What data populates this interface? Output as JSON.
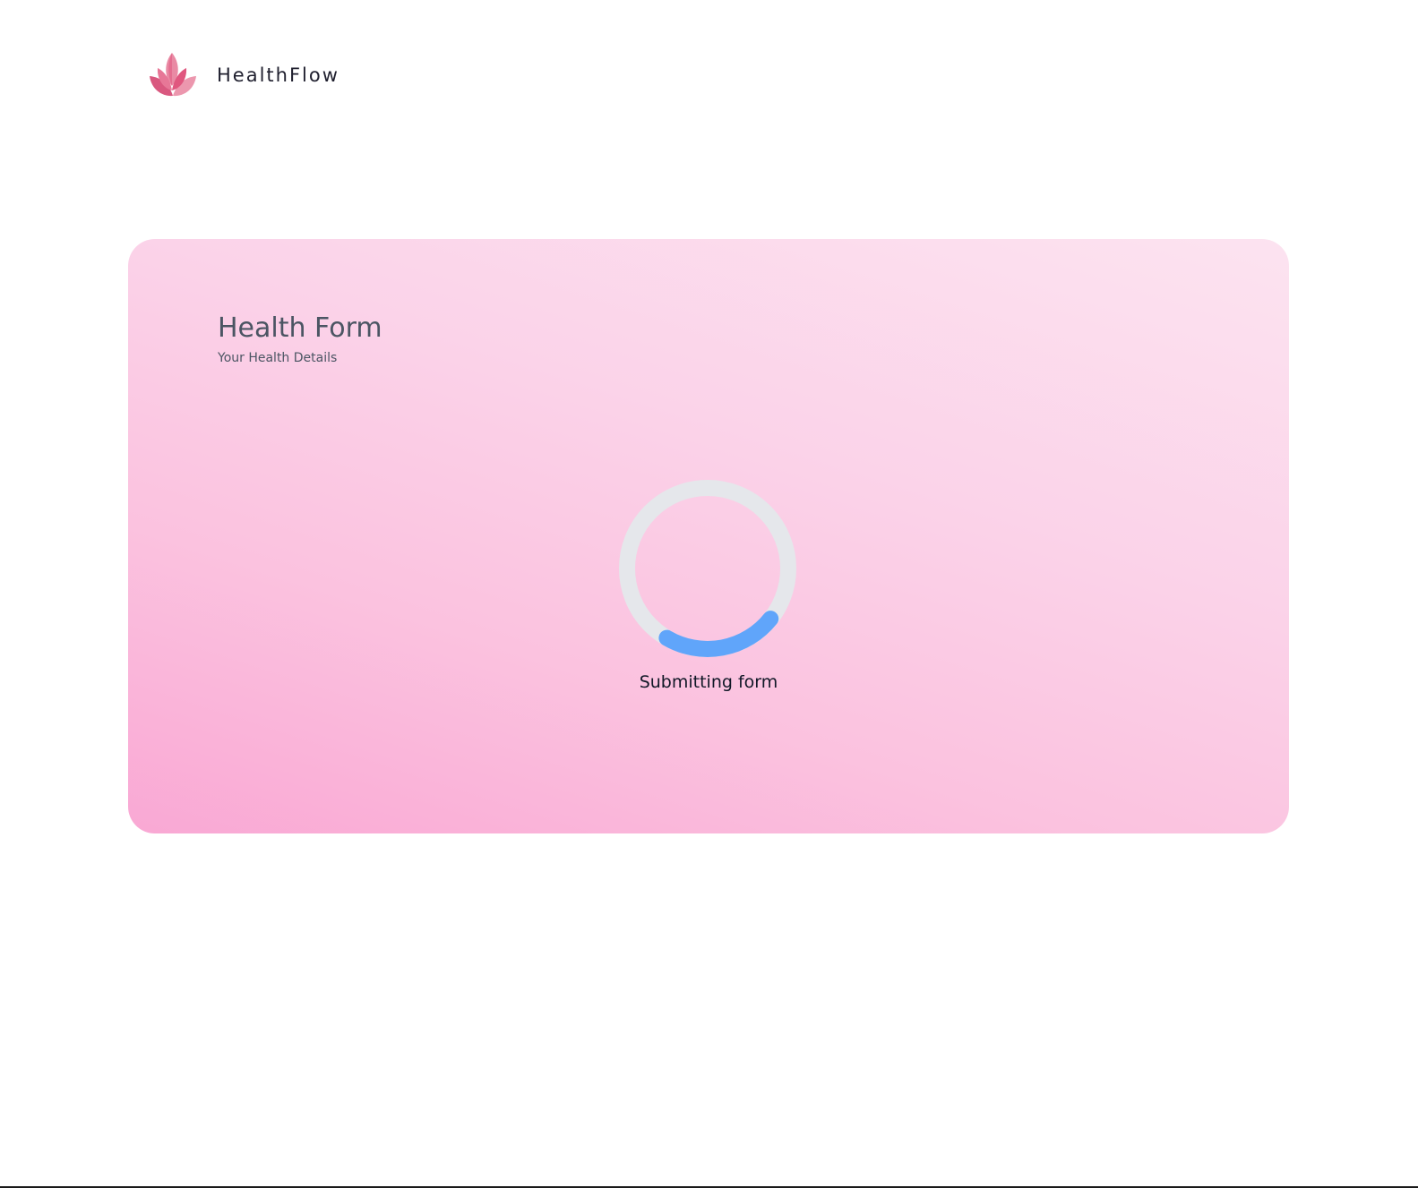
{
  "brand": {
    "name": "HealthFlow",
    "logo_icon": "lotus-icon",
    "logo_colors": [
      "#e0577f",
      "#e98aa4",
      "#d9728f"
    ]
  },
  "form": {
    "title": "Health Form",
    "subtitle": "Your Health Details",
    "status": "Submitting form"
  },
  "spinner": {
    "icon": "loading-spinner",
    "track_color": "#e5e7eb",
    "arc_color": "#60a5fa"
  },
  "theme": {
    "card_gradient": [
      "#f9a8d4",
      "#fce3f0"
    ],
    "text_color": "#4b5563"
  }
}
